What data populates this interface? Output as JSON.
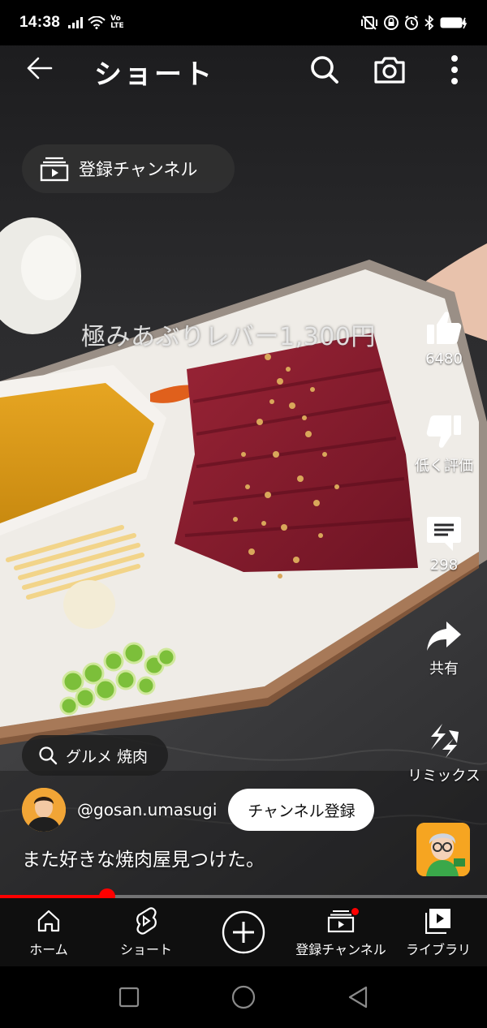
{
  "status_bar": {
    "time": "14:38",
    "network_label": "Vo LTE"
  },
  "header": {
    "title": "ショート"
  },
  "subscriptions_chip": {
    "label": "登録チャンネル"
  },
  "video": {
    "overlay_caption": "極みあぶりレバー1,300円",
    "title": "また好きな焼肉屋見つけた。",
    "progress_fraction": 0.22
  },
  "actions": {
    "like_count": "6480",
    "dislike_label": "低く評価",
    "comment_count": "298",
    "share_label": "共有",
    "remix_label": "リミックス"
  },
  "search_chip": {
    "label": "グルメ 焼肉"
  },
  "channel": {
    "handle": "@gosan.umasugi",
    "subscribe_label": "チャンネル登録"
  },
  "bottom_nav": {
    "items": [
      {
        "label": "ホーム",
        "icon": "home-icon"
      },
      {
        "label": "ショート",
        "icon": "shorts-icon"
      },
      {
        "label": "",
        "icon": "create-plus-icon"
      },
      {
        "label": "登録チャンネル",
        "icon": "subscriptions-icon",
        "notification_dot": true
      },
      {
        "label": "ライブラリ",
        "icon": "library-icon"
      }
    ]
  },
  "colors": {
    "accent": "#ff0000",
    "nav_background": "#0f0f0f"
  }
}
